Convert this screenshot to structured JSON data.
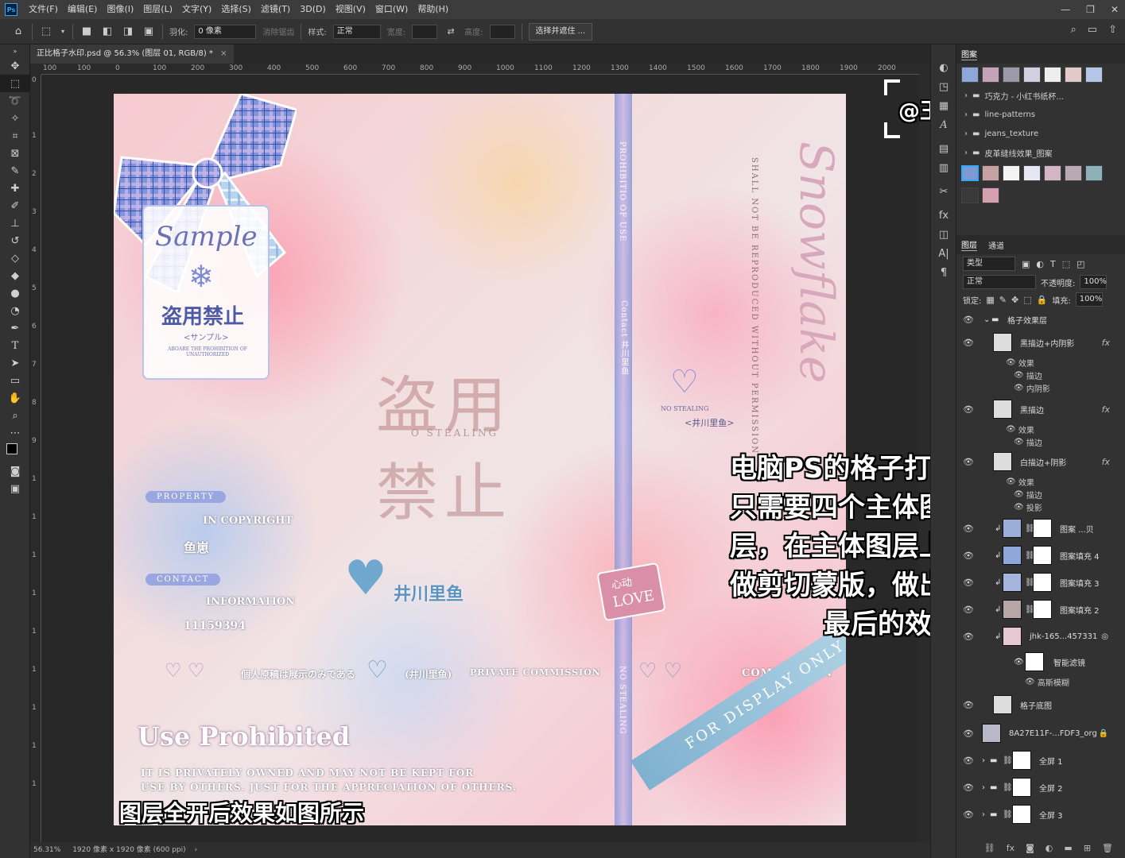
{
  "menubar": {
    "app_icon": "Ps",
    "items": [
      "文件(F)",
      "编辑(E)",
      "图像(I)",
      "图层(L)",
      "文字(Y)",
      "选择(S)",
      "滤镜(T)",
      "3D(D)",
      "视图(V)",
      "窗口(W)",
      "帮助(H)"
    ],
    "window_controls": [
      "—",
      "❐",
      "✕"
    ]
  },
  "options": {
    "feather_label": "羽化:",
    "feather_value": "0 像素",
    "antialias_label": "消除锯齿",
    "style_label": "样式:",
    "style_value": "正常",
    "width_label": "宽度:",
    "height_label": "高度:",
    "select_mask_button": "选择并遮住 ..."
  },
  "document": {
    "tab_title": "正比格子水印.psd @ 56.3% (图层 01, RGB/8) *",
    "tab_close": "×",
    "zoom": "56.31%",
    "doc_size": "1920 像素 x 1920 像素 (600 ppi)",
    "ruler_h_labels": [
      "100",
      "100",
      "0",
      "100",
      "200",
      "300",
      "400",
      "500",
      "600",
      "700",
      "800",
      "900",
      "1000",
      "1100",
      "1200",
      "1300",
      "1400",
      "1500",
      "1600",
      "1700",
      "1800",
      "1900",
      "2000"
    ],
    "ruler_v_labels": [
      "0",
      "1",
      "2",
      "3",
      "4",
      "5",
      "6",
      "7",
      "8",
      "9",
      "1",
      "1",
      "1",
      "1",
      "1",
      "1",
      "1",
      "1",
      "1"
    ]
  },
  "artwork": {
    "sample_title": "Sample",
    "tag_kanji": "盗用禁止",
    "tag_kana": "<サンプル>",
    "tag_small": "ABOARE THE PROHIBITION OF UNAUTHORIZED",
    "center_kanji_top": "盗用",
    "center_kanji_bottom": "禁止",
    "center_no_stealing": "O STEALING",
    "spine_top": "PROHIBITIO OF USE",
    "spine_contact": "Contact 井川里鱼",
    "spine_bottom": "NO STEALING",
    "right_script": "Snowflake",
    "right_vertical": "SHALL NOT BE REPRODUCED WITHOUT PERMISSION",
    "no_stealing_small": "NO STEALING",
    "author_small": "<井川里鱼>",
    "property_badge": "PROPERTY",
    "in_copyright": "IN COPYRIGHT",
    "name_small": "鱼崽",
    "contact_badge": "CONTACT",
    "information": "INFORMATION",
    "number": "11159394",
    "brand_name": "井川里鱼",
    "love_tag_top": "心动",
    "love_tag_bottom": "LOVE",
    "line_jp": "個人原稿は展示のみである",
    "line_author": "(井川里鱼)",
    "line_private": "PRIVATE COMMISSION",
    "commission": "COMMISSION",
    "use_prohibited": "Use Prohibited",
    "use_line1": "IT IS PRIVATELY OWNED AND MAY NOT BE KEPT FOR",
    "use_line2": "USE BY OTHERS. JUST FOR THE APPRECIATION OF OTHERS.",
    "ribbon_text": "FOR DISPLAY ONLY"
  },
  "overlay": {
    "watermark": "@王多鱼 | 小红书",
    "caption_lines": [
      "电脑PS的格子打法",
      "只需要四个主体图",
      "层，在主体图层上",
      "做剪切蒙版，做出",
      "最后的效果"
    ],
    "bottom_caption": "图层全开后效果如图所示"
  },
  "patterns_panel": {
    "title": "图案",
    "folders": [
      "巧克力 - 小红书纸杯...",
      "line-patterns",
      "jeans_texture",
      "皮革缝线效果_图案"
    ]
  },
  "layers_panel": {
    "tabs": [
      "图层",
      "通道"
    ],
    "filter_label": "类型",
    "blend_mode": "正常",
    "opacity_label": "不透明度:",
    "opacity_value": "100%",
    "lock_label": "锁定:",
    "fill_label": "填充:",
    "fill_value": "100%",
    "group_name": "格子效果层",
    "layers": [
      {
        "name": "黑描边+内阴影",
        "fx": "fx",
        "effects_label": "效果",
        "effects": [
          "描边",
          "内阴影"
        ]
      },
      {
        "name": "黑描边",
        "fx": "fx",
        "effects_label": "效果",
        "effects": [
          "描边"
        ]
      },
      {
        "name": "白描边+阴影",
        "fx": "fx",
        "effects_label": "效果",
        "effects": [
          "描边",
          "投影"
        ]
      },
      {
        "name": "图案 ...贝"
      },
      {
        "name": "图案填充 4"
      },
      {
        "name": "图案填充 3"
      },
      {
        "name": "图案填充 2"
      },
      {
        "name": "jhk-165...457331",
        "smart_filters": "智能滤镜",
        "filter": "高斯模糊"
      },
      {
        "name": "格子底图"
      },
      {
        "name": "8A27E11F-...FDF3_org"
      },
      {
        "name": "全屏 1"
      },
      {
        "name": "全屏 2"
      },
      {
        "name": "全屏 3"
      }
    ]
  },
  "colors": {
    "ui_bg": "#323232",
    "canvas_bg": "#282828",
    "accent_blue": "#31a8ff",
    "art_pink": "#f3c7cf",
    "art_blue": "#7f95d6"
  }
}
